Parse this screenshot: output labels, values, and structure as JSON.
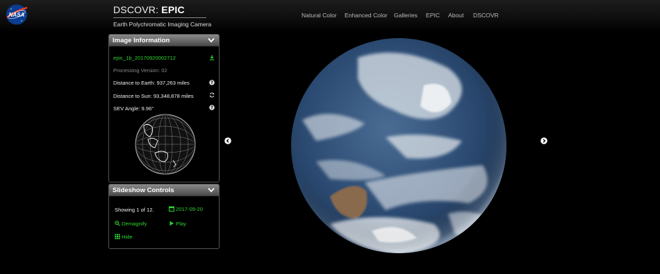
{
  "header": {
    "brand_prefix": "DSCOVR: ",
    "brand_name": "EPIC",
    "subtitle": "Earth Polychromatic Imaging Camera",
    "logo_text": "NASA",
    "nav": [
      "Natural Color",
      "Enhanced Color",
      "Galleries",
      "EPIC",
      "About",
      "DSCOVR"
    ]
  },
  "image_info": {
    "title": "Image Information",
    "filename": "epic_1b_20170920002712",
    "processing": "Processing Version: 02",
    "distance_earth": "Distance to Earth: 937,263 miles",
    "distance_sun": "Distance to Sun: 93,348,878 miles",
    "sev_angle": "SEV Angle: 9.96°"
  },
  "slideshow": {
    "title": "Slideshow Controls",
    "showing": "Showing 1 of 12.",
    "date": "2017-09-20",
    "demagnify": "Demagnify",
    "play": "Play",
    "hide": "Hide"
  },
  "colors": {
    "accent": "#2fd332",
    "panel_header": "#6e6e6e",
    "background": "#000000"
  },
  "icons": [
    "nasa-logo",
    "download-icon",
    "question-icon",
    "refresh-icon",
    "chevron-down-icon",
    "calendar-icon",
    "zoom-out-icon",
    "play-icon",
    "grid-icon",
    "arrow-left-icon",
    "arrow-right-icon",
    "globe-wireframe-icon"
  ]
}
